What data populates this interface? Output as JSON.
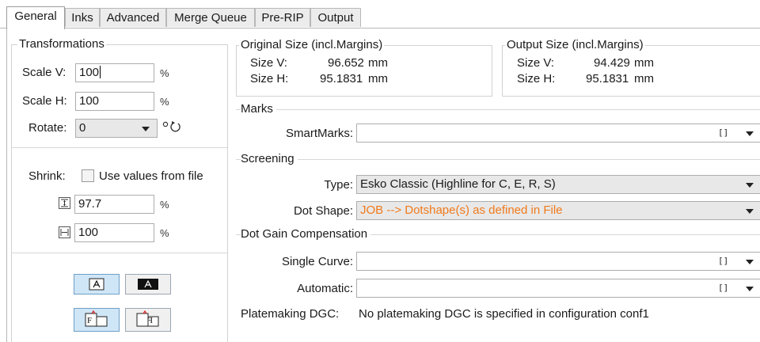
{
  "tabs": [
    "General",
    "Inks",
    "Advanced",
    "Merge Queue",
    "Pre-RIP",
    "Output"
  ],
  "transformations": {
    "title": "Transformations",
    "scale_v_label": "Scale V:",
    "scale_v_value": "100",
    "scale_v_unit": "%",
    "scale_h_label": "Scale H:",
    "scale_h_value": "100",
    "scale_h_unit": "%",
    "rotate_label": "Rotate:",
    "rotate_value": "0",
    "shrink_label": "Shrink:",
    "shrink_checkbox_label": "Use values from file",
    "shrink_v_value": "97.7",
    "shrink_v_unit": "%",
    "shrink_h_value": "100",
    "shrink_h_unit": "%"
  },
  "original_size": {
    "title": "Original Size (incl.Margins)",
    "v_label": "Size V:",
    "v_value": "96.652",
    "v_unit": "mm",
    "h_label": "Size H:",
    "h_value": "95.1831",
    "h_unit": "mm"
  },
  "output_size": {
    "title": "Output Size (incl.Margins)",
    "v_label": "Size V:",
    "v_value": "94.429",
    "v_unit": "mm",
    "h_label": "Size H:",
    "h_value": "95.1831",
    "h_unit": "mm"
  },
  "marks": {
    "title": "Marks",
    "smartmarks_label": "SmartMarks:",
    "smartmarks_value": "",
    "bracket": "[]"
  },
  "screening": {
    "title": "Screening",
    "type_label": "Type:",
    "type_value": "Esko Classic (Highline for C, E, R, S)",
    "dot_shape_label": "Dot Shape:",
    "dot_shape_value": "JOB --> Dotshape(s) as defined in File",
    "dot_shape_color": "#f07a1c"
  },
  "dgc": {
    "title": "Dot Gain Compensation",
    "single_curve_label": "Single Curve:",
    "single_curve_value": "",
    "automatic_label": "Automatic:",
    "automatic_value": "",
    "bracket": "[]",
    "platemaking_label": "Platemaking DGC:",
    "platemaking_value": "No platemaking DGC is specified in configuration conf1"
  }
}
